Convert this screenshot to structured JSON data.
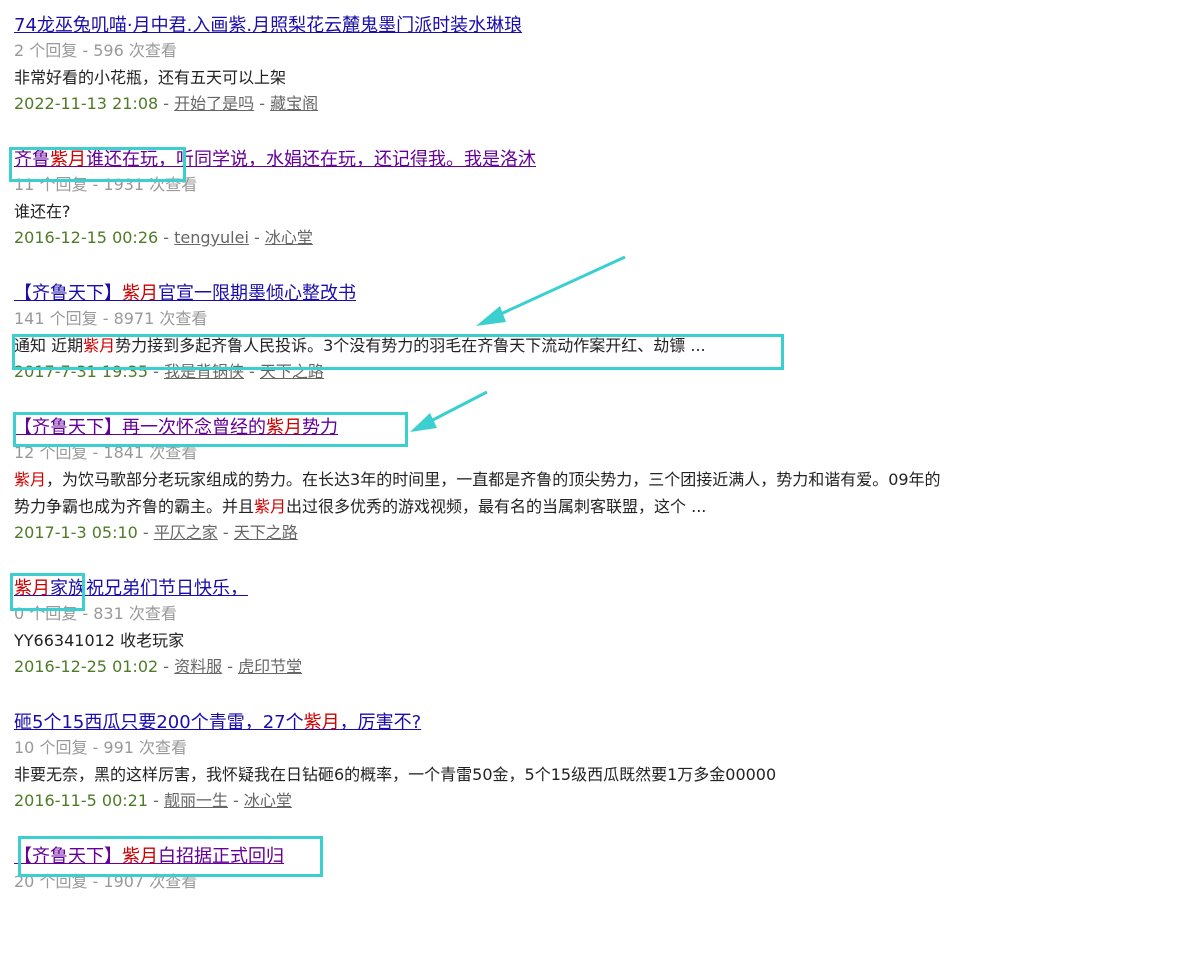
{
  "results": [
    {
      "title": "74龙巫兔叽喵·月中君.入画紫.月照梨花云麓鬼墨门派时装水琳琅",
      "meta": "2 个回复 - 596 次查看",
      "snippet_pre": "非常好看的小花瓶，还有五天可以上架",
      "date": "2022-11-13 21:08",
      "author": "开始了是吗",
      "forum": "藏宝阁"
    },
    {
      "title_pre": "齐鲁",
      "title_kw": "紫月",
      "title_post": "谁还在玩，听同学说，水娟还在玩，还记得我。我是洛沐",
      "meta": "11 个回复 - 1931 次查看",
      "snippet_pre": "谁还在?",
      "date": "2016-12-15 00:26",
      "author": "tengyulei",
      "forum": "冰心堂"
    },
    {
      "title_pre": "【齐鲁天下】",
      "title_kw": "紫月",
      "title_post": "官宣一限期墨倾心整改书",
      "meta": "141 个回复 - 8971 次查看",
      "snippet_pre": "通知 近期",
      "snippet_kw": "紫月",
      "snippet_post": "势力接到多起齐鲁人民投诉。3个没有势力的羽毛在齐鲁天下流动作案开红、劫镖 ...",
      "date": "2017-7-31 19:35",
      "author": "我是背锅侠",
      "forum": "天下之路"
    },
    {
      "title_pre": "【齐鲁天下】再一次怀念曾经的",
      "title_kw": "紫月",
      "title_post": "势力",
      "meta": "12 个回复 - 1841 次查看",
      "snippet_kw": "紫月",
      "snippet_mid": "，为饮马歌部分老玩家组成的势力。在长达3年的时间里，一直都是齐鲁的顶尖势力，三个团接近满人，势力和谐有爱。09年的势力争霸也成为齐鲁的霸主。并且",
      "snippet_kw2": "紫月",
      "snippet_post": "出过很多优秀的游戏视频，最有名的当属刺客联盟，这个 ...",
      "date": "2017-1-3 05:10",
      "author": "平仄之家",
      "forum": "天下之路"
    },
    {
      "title_kw": "紫月",
      "title_post": "家族祝兄弟们节日快乐，",
      "meta": "0 个回复 - 831 次查看",
      "snippet_pre": "YY66341012 收老玩家",
      "date": "2016-12-25 01:02",
      "author": "资料服",
      "forum": "虎印节堂"
    },
    {
      "title_pre": "砸5个15西瓜只要200个青雷，27个",
      "title_kw": "紫月",
      "title_post": "，厉害不?",
      "meta": "10 个回复 - 991 次查看",
      "snippet_pre": "非要无奈，黑的这样厉害，我怀疑我在日钻砸6的概率，一个青雷50金，5个15级西瓜既然要1万多金00000",
      "date": "2016-11-5 00:21",
      "author": "靓丽一生",
      "forum": "冰心堂"
    },
    {
      "title_pre": "【齐鲁天下】",
      "title_kw": "紫月",
      "title_post": "白招据正式回归",
      "meta": "20 个回复 - 1907 次查看"
    }
  ],
  "separator": " - ",
  "colors": {
    "link": "#1a0dab",
    "visited": "#660099",
    "keyword": "#d00000",
    "date": "#4e7b26",
    "meta": "#999999",
    "annotation": "#3ccfcf"
  }
}
